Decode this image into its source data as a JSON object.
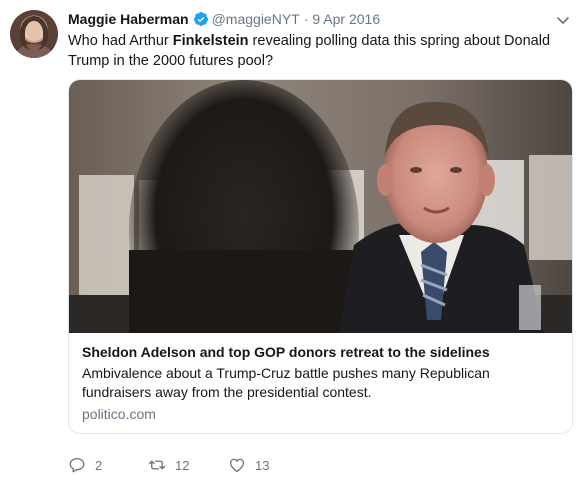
{
  "author": {
    "name": "Maggie Haberman",
    "handle": "@maggieNYT",
    "separator": "·",
    "date": "9 Apr 2016"
  },
  "tweet": {
    "text_before": "Who had Arthur ",
    "text_bold": "Finkelstein",
    "text_after": " revealing polling data this spring about Donald Trump in the 2000 futures pool?"
  },
  "card": {
    "title": "Sheldon Adelson and top GOP donors retreat to the sidelines",
    "description": "Ambivalence about a Trump-Cruz battle pushes many Republican fundraisers away from the presidential contest.",
    "domain": "politico.com"
  },
  "actions": {
    "reply_count": "2",
    "retweet_count": "12",
    "like_count": "13"
  },
  "icons": {
    "verified": "verified-badge-icon",
    "menu": "chevron-down-icon",
    "reply": "reply-icon",
    "retweet": "retweet-icon",
    "like": "heart-icon"
  },
  "colors": {
    "accent": "#1da1f2",
    "muted": "#657786",
    "text": "#14171a",
    "border": "#e1e8ed"
  }
}
